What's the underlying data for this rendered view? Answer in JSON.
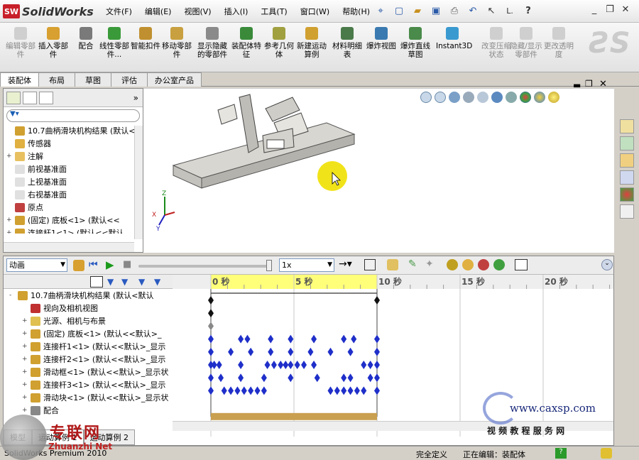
{
  "app": {
    "brand_prefix": "SW",
    "name": "SolidWorks"
  },
  "menu": [
    "文件(F)",
    "编辑(E)",
    "视图(V)",
    "插入(I)",
    "工具(T)",
    "窗口(W)",
    "帮助(H)"
  ],
  "quick_access": {
    "select_label": "L.",
    "help": "?"
  },
  "commands": [
    {
      "label": "编辑零部件",
      "enabled": false,
      "color": "#9a9a9a"
    },
    {
      "label": "插入零部件",
      "enabled": true,
      "color": "#d8a030"
    },
    {
      "label": "配合",
      "enabled": true,
      "color": "#7a7a7a"
    },
    {
      "label": "线性零部件...",
      "enabled": true,
      "color": "#3a9a3a"
    },
    {
      "label": "智能扣件",
      "enabled": true,
      "color": "#c09030"
    },
    {
      "label": "移动零部件",
      "enabled": true,
      "color": "#c8a040"
    },
    {
      "label": "显示隐藏的零部件",
      "enabled": true,
      "color": "#8a8a8a"
    },
    {
      "label": "装配体特征",
      "enabled": true,
      "color": "#3a8a3a"
    },
    {
      "label": "参考几何体",
      "enabled": true,
      "color": "#a0a040"
    },
    {
      "label": "新建运动算例",
      "enabled": true,
      "color": "#d0a030"
    },
    {
      "label": "材料明细表",
      "enabled": true,
      "color": "#4a7a4a"
    },
    {
      "label": "爆炸视图",
      "enabled": true,
      "color": "#3a7ab0"
    },
    {
      "label": "爆炸直线草图",
      "enabled": true,
      "color": "#4a8a4a"
    },
    {
      "label": "Instant3D",
      "enabled": true,
      "color": "#3a9ad0"
    },
    {
      "label": "改变压缩状态",
      "enabled": false,
      "color": "#9a9a9a"
    },
    {
      "label": "隐藏/显示零部件",
      "enabled": false,
      "color": "#9a9a9a"
    },
    {
      "label": "更改透明度",
      "enabled": false,
      "color": "#9a9a9a"
    }
  ],
  "tabs": [
    "装配体",
    "布局",
    "草图",
    "评估",
    "办公室产品"
  ],
  "feature_tree": [
    {
      "label": "10.7曲柄滑块机构结果  (默认<",
      "icon": "#d0a030",
      "expander": ""
    },
    {
      "label": "传感器",
      "icon": "#e0b040",
      "expander": ""
    },
    {
      "label": "注解",
      "icon": "#e8c060",
      "expander": "+"
    },
    {
      "label": "前视基准面",
      "icon": "#e0e0e0",
      "expander": ""
    },
    {
      "label": "上视基准面",
      "icon": "#e0e0e0",
      "expander": ""
    },
    {
      "label": "右视基准面",
      "icon": "#e0e0e0",
      "expander": ""
    },
    {
      "label": "原点",
      "icon": "#c04040",
      "expander": ""
    },
    {
      "label": "(固定) 底板<1> (默认<<",
      "icon": "#d0a030",
      "expander": "+"
    },
    {
      "label": "连接杆1<1> (默认<<默认",
      "icon": "#d0a030",
      "expander": "+"
    }
  ],
  "motion": {
    "study_type": "动画",
    "speed": "1x",
    "ruler_labels": [
      "0 秒",
      "5 秒",
      "10 秒",
      "15 秒",
      "20 秒"
    ],
    "tree": [
      {
        "label": "10.7曲柄滑块机构结果  (默认<默认",
        "expander": "-",
        "icon": "#d0a030"
      },
      {
        "label": "视向及相机视图",
        "expander": "",
        "icon": "#c03030"
      },
      {
        "label": "光源、相机与布景",
        "expander": "+",
        "icon": "#e0c050"
      },
      {
        "label": "(固定) 底板<1> (默认<<默认>_",
        "expander": "+",
        "icon": "#d0a030"
      },
      {
        "label": "连接杆1<1> (默认<<默认>_显示",
        "expander": "+",
        "icon": "#d0a030"
      },
      {
        "label": "连接杆2<1> (默认<<默认>_显示",
        "expander": "+",
        "icon": "#d0a030"
      },
      {
        "label": "滑动框<1> (默认<<默认>_显示状",
        "expander": "+",
        "icon": "#d0a030"
      },
      {
        "label": "连接杆3<1> (默认<<默认>_显示",
        "expander": "+",
        "icon": "#d0a030"
      },
      {
        "label": "滑动块<1> (默认<<默认>_显示状",
        "expander": "+",
        "icon": "#d0a030"
      },
      {
        "label": "配合",
        "expander": "+",
        "icon": "#888888"
      }
    ],
    "tabs": [
      "模型",
      "运动算例 1",
      "运动算例 2"
    ]
  },
  "status": {
    "left": "SolidWorks Premium 2010",
    "define": "完全定义",
    "editing": "正在编辑：装配体"
  },
  "watermarks": {
    "site_name": "专联网",
    "site_net": "Zhuanzhi Net",
    "url": "www.caxsp.com",
    "slogan": "视 频 教 程 服 务 网"
  },
  "colors": {
    "keyframe": "#1f2fc9",
    "timebar": "#ffff7a",
    "track": "#c9a050",
    "cursor": "#f0e000"
  }
}
